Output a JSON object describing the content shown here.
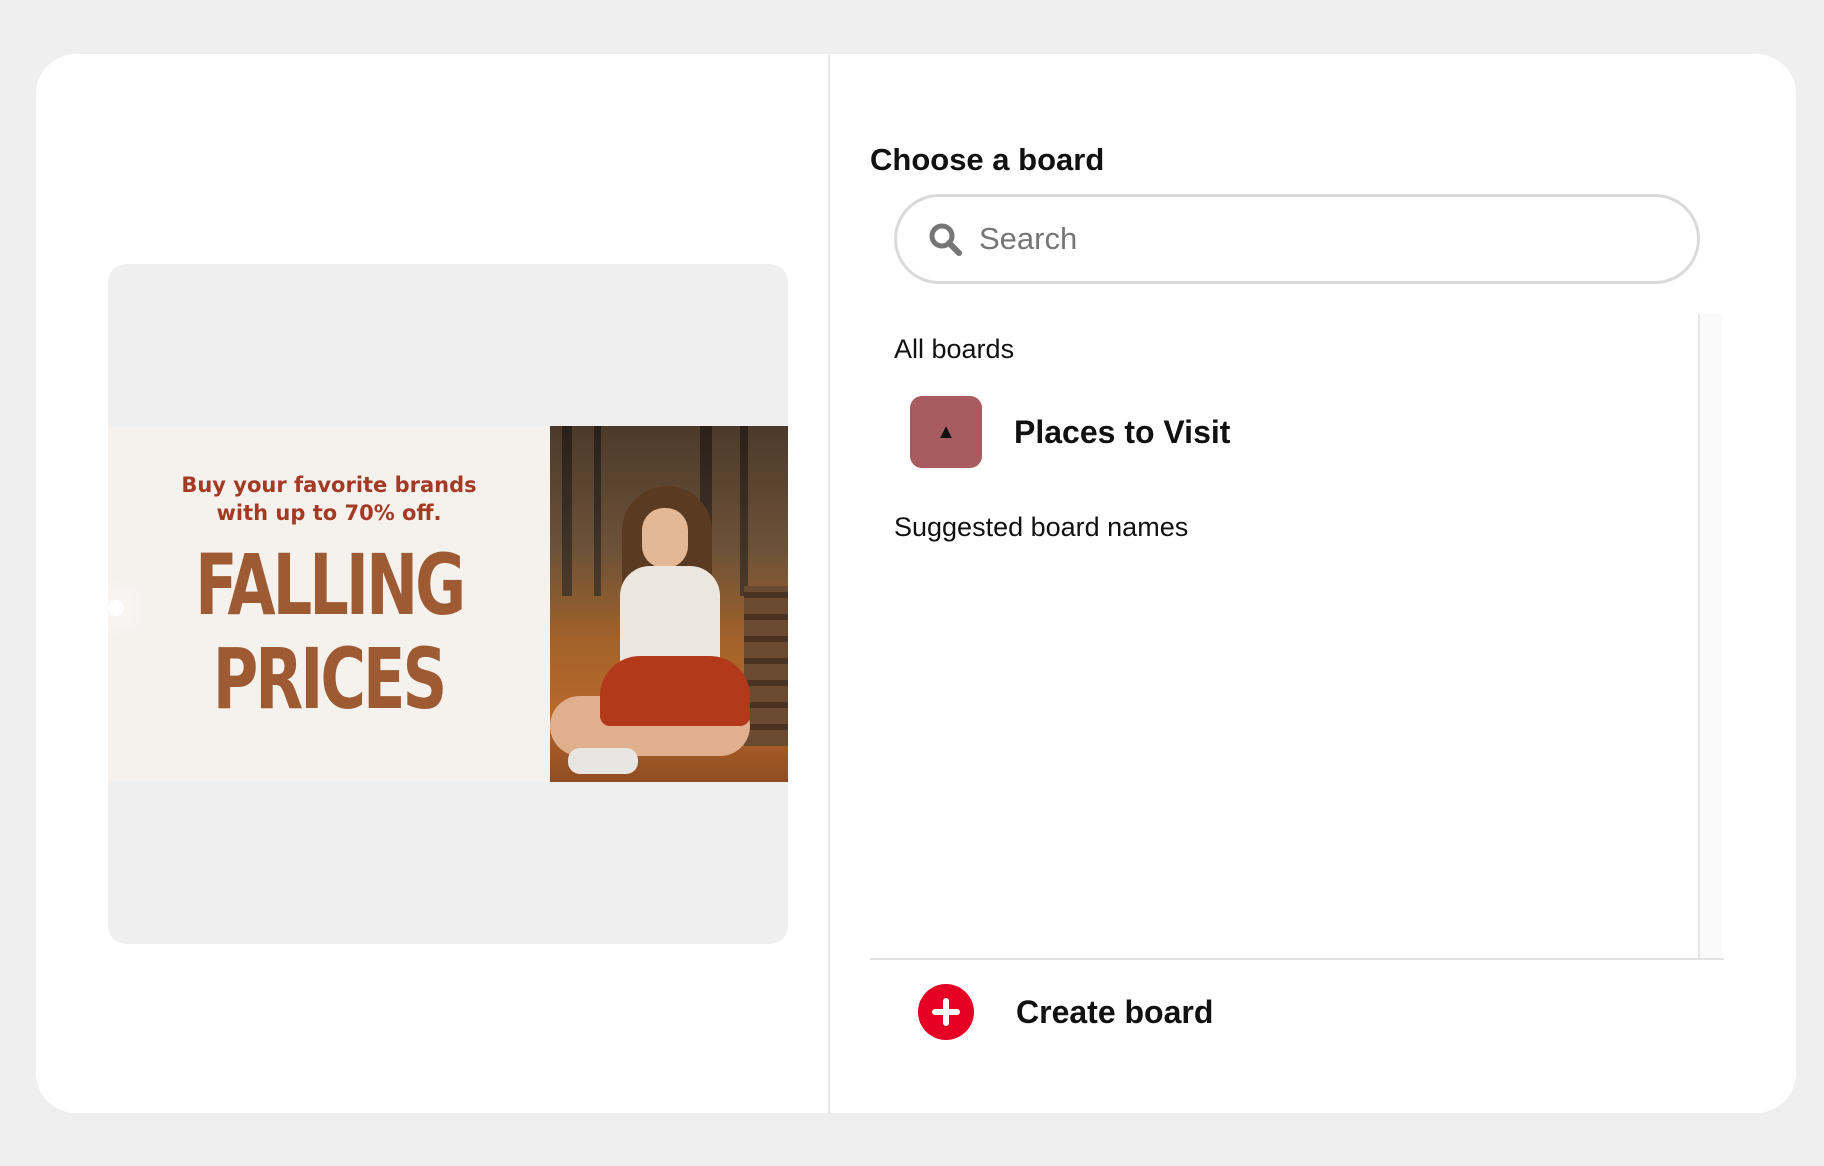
{
  "pin_preview": {
    "tagline": "Buy your favorite brands with up to 70% off.",
    "headline_line1": "FALLING",
    "headline_line2": "PRICES"
  },
  "board_picker": {
    "title": "Choose a board",
    "search": {
      "placeholder": "Search",
      "value": ""
    },
    "all_boards_label": "All boards",
    "boards": [
      {
        "name": "Places to Visit",
        "thumb_glyph": "▲",
        "thumb_color": "#a85c60"
      }
    ],
    "suggested_label": "Suggested board names",
    "create_label": "Create board"
  },
  "colors": {
    "accent": "#e60023",
    "tagline": "#a33a24",
    "headline": "#9e5a32"
  }
}
